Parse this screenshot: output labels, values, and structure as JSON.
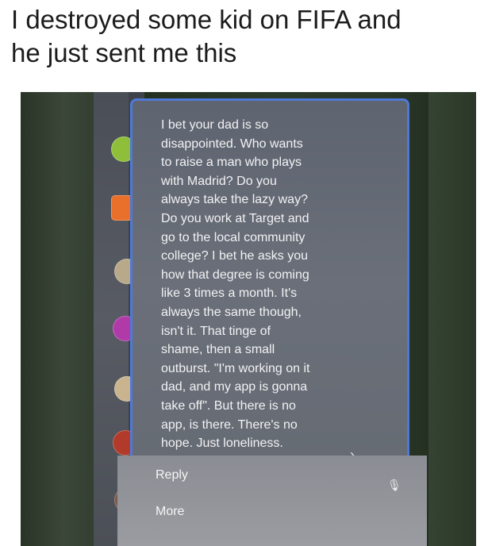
{
  "caption": "I destroyed some kid on FIFA and\nhe just sent me this",
  "message": {
    "body": "I bet your dad is so\ndisappointed. Who wants\nto raise a man who plays\nwith Madrid? Do you\nalways take the lazy way?\nDo you work at Target and\ngo to the local community\ncollege? I bet he asks you\nhow that degree is coming\nlike 3 times a month. It's\nalways the same though,\nisn't it. That tinge of\nshame, then a small\noutburst. \"I'm working on it\ndad, and my app is gonna\ntake off\". But there is no\napp, is there. There's no\nhope. Just loneliness."
  },
  "actions": {
    "reply_label": "Reply",
    "more_label": "More"
  },
  "icons": {
    "chevron": "chevron-right-icon",
    "mic": "microphone-icon"
  },
  "colors": {
    "selection_border": "#4f79d8"
  }
}
